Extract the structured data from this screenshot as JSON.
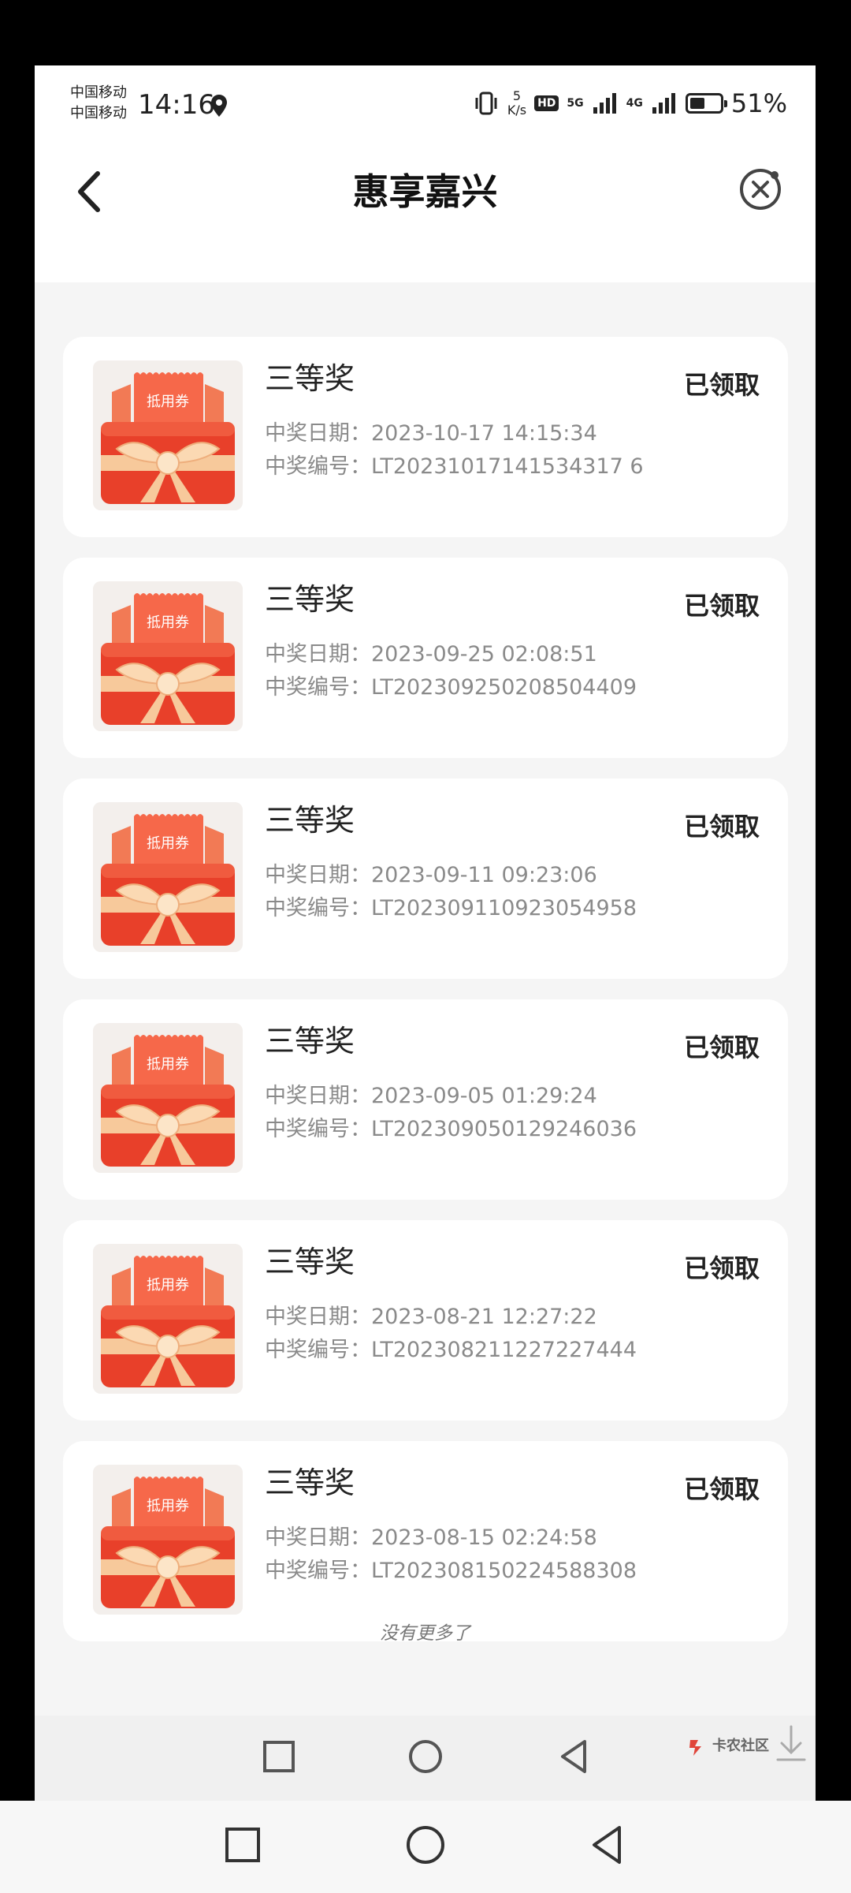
{
  "status_bar": {
    "carrier_1": "中国移动",
    "carrier_2": "中国移动",
    "time": "14:16",
    "speed_value": "5",
    "speed_unit": "K/s",
    "hd_badge": "HD",
    "network_1": "5G",
    "network_2": "4G",
    "battery_percent": "51%",
    "battery_level": 0.51
  },
  "header": {
    "title": "惠享嘉兴"
  },
  "thumb_label": "抵用券",
  "records": [
    {
      "prize": "三等奖",
      "status": "已领取",
      "date": "中奖日期：2023-10-17 14:15:34",
      "code": "中奖编号：LT20231017141534317 6"
    },
    {
      "prize": "三等奖",
      "status": "已领取",
      "date": "中奖日期：2023-09-25 02:08:51",
      "code": "中奖编号：LT202309250208504409"
    },
    {
      "prize": "三等奖",
      "status": "已领取",
      "date": "中奖日期：2023-09-11 09:23:06",
      "code": "中奖编号：LT202309110923054958"
    },
    {
      "prize": "三等奖",
      "status": "已领取",
      "date": "中奖日期：2023-09-05 01:29:24",
      "code": "中奖编号：LT202309050129246036"
    },
    {
      "prize": "三等奖",
      "status": "已领取",
      "date": "中奖日期：2023-08-21 12:27:22",
      "code": "中奖编号：LT202308211227227444"
    },
    {
      "prize": "三等奖",
      "status": "已领取",
      "date": "中奖日期：2023-08-15 02:24:58",
      "code": "中奖编号：LT202308150224588308"
    }
  ],
  "footer": {
    "no_more": "没有更多了"
  },
  "watermark": {
    "text": "卡农社区"
  },
  "colors": {
    "accent_red": "#f04a2e",
    "ribbon": "#f7c79a",
    "background": "#f5f5f5"
  }
}
